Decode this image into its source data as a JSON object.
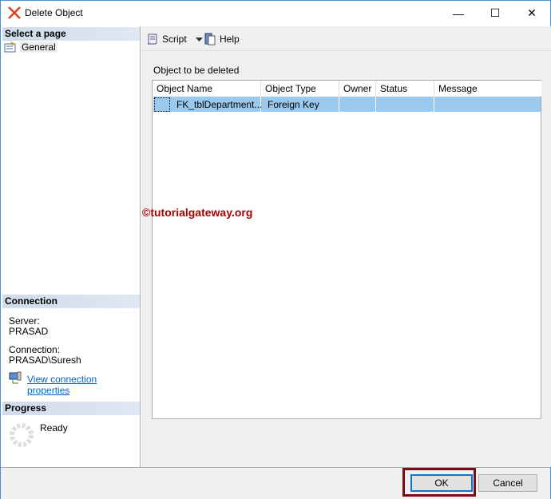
{
  "window": {
    "title": "Delete Object",
    "minimize": "—",
    "maximize": "☐",
    "close": "✕"
  },
  "left": {
    "select_page": "Select a page",
    "pages": [
      {
        "label": "General"
      }
    ],
    "connection": {
      "header": "Connection",
      "server_label": "Server:",
      "server": "PRASAD",
      "connection_label": "Connection:",
      "connection": "PRASAD\\Suresh",
      "link": "View connection properties"
    },
    "progress": {
      "header": "Progress",
      "status": "Ready"
    }
  },
  "toolbar": {
    "script": "Script",
    "help": "Help"
  },
  "main": {
    "label": "Object to be deleted",
    "columns": [
      "Object Name",
      "Object Type",
      "Owner",
      "Status",
      "Message"
    ],
    "rows": [
      {
        "name": "FK_tblDepartment...",
        "type": "Foreign Key",
        "owner": "",
        "status": "",
        "message": ""
      }
    ]
  },
  "watermark": "©tutorialgateway.org",
  "buttons": {
    "ok": "OK",
    "cancel": "Cancel"
  }
}
